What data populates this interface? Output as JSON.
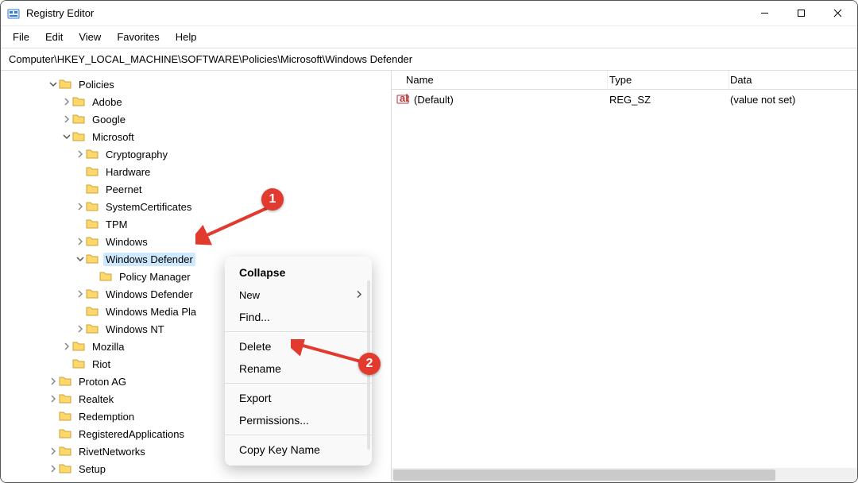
{
  "window": {
    "title": "Registry Editor"
  },
  "menu": {
    "file": "File",
    "edit": "Edit",
    "view": "View",
    "favorites": "Favorites",
    "help": "Help"
  },
  "address": "Computer\\HKEY_LOCAL_MACHINE\\SOFTWARE\\Policies\\Microsoft\\Windows Defender",
  "columns": {
    "name": "Name",
    "type": "Type",
    "data": "Data"
  },
  "rows": {
    "default": {
      "name": "(Default)",
      "type": "REG_SZ",
      "data": "(value not set)"
    }
  },
  "tree": {
    "policies": "Policies",
    "adobe": "Adobe",
    "google": "Google",
    "microsoft": "Microsoft",
    "cryptography": "Cryptography",
    "hardware": "Hardware",
    "peernet": "Peernet",
    "systemcerts": "SystemCertificates",
    "tpm": "TPM",
    "windows": "Windows",
    "windows_defender": "Windows Defender",
    "policy_manager": "Policy Manager",
    "windows_defender2": "Windows Defender",
    "wmp": "Windows Media Pla",
    "windows_nt": "Windows NT",
    "mozilla": "Mozilla",
    "riot": "Riot",
    "proton": "Proton AG",
    "realtek": "Realtek",
    "redemption": "Redemption",
    "reg_apps": "RegisteredApplications",
    "rivet": "RivetNetworks",
    "setup": "Setup"
  },
  "context_menu": {
    "collapse": "Collapse",
    "new": "New",
    "find": "Find...",
    "delete": "Delete",
    "rename": "Rename",
    "export": "Export",
    "permissions": "Permissions...",
    "copy_key": "Copy Key Name"
  },
  "marker1": "1",
  "marker2": "2"
}
